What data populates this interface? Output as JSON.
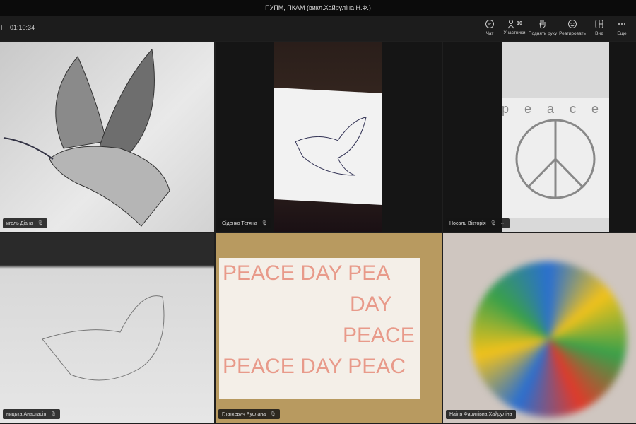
{
  "title": "ПУПМ, ПКАМ (викл.Хайруліна Н.Ф.)",
  "timer": "01:10:34",
  "toolbar": {
    "chat": "Чат",
    "participants": "Участники",
    "participants_count": "10",
    "raise_hand": "Поднять руку",
    "react": "Реагировать",
    "view": "Вид",
    "more": "Еще"
  },
  "participants": [
    {
      "name": "иголь Діана"
    },
    {
      "name": "Сіденко Тетяна"
    },
    {
      "name": "Носаль Вікторія"
    },
    {
      "name": "ницька Анастасія"
    },
    {
      "name": "Глаткевич Руслана"
    },
    {
      "name": "Наіля Фаритівна Хайруліна"
    }
  ],
  "poster": {
    "line1": "PEACE DAY PEA",
    "line2": "DAY",
    "line3": "PEACE",
    "line4": "PEACE DAY PEAC"
  },
  "paper_text": "peace"
}
